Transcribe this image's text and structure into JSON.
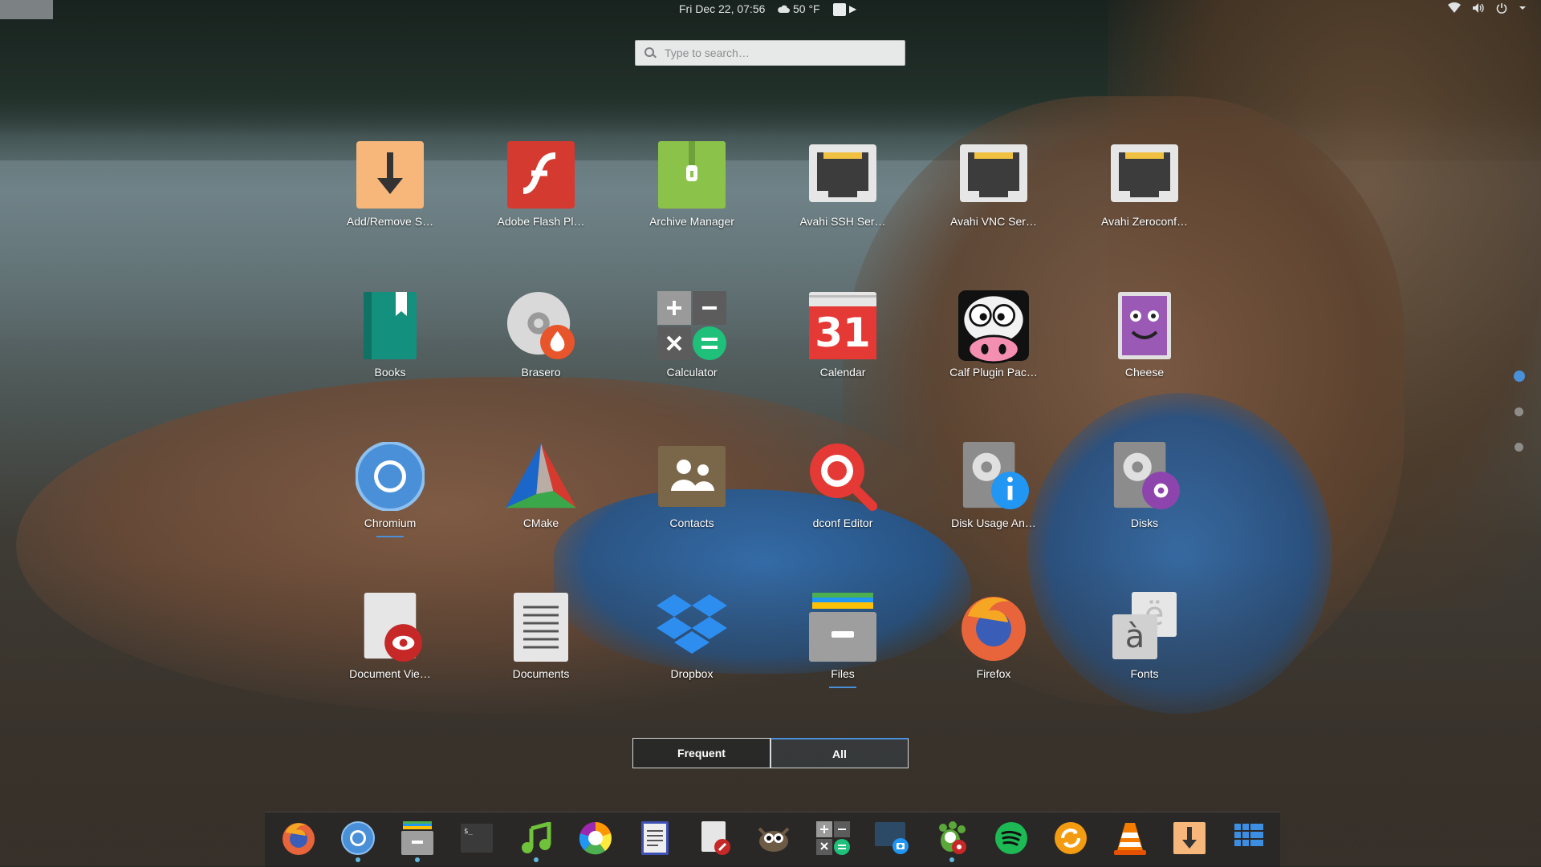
{
  "topbar": {
    "clock": "Fri Dec 22, 07:56",
    "weather": "50 °F"
  },
  "search": {
    "placeholder": "Type to search…"
  },
  "apps": [
    {
      "label": "Add/Remove S…",
      "icon": "package-install-icon",
      "running": false
    },
    {
      "label": "Adobe Flash Pl…",
      "icon": "flash-icon",
      "running": false
    },
    {
      "label": "Archive Manager",
      "icon": "archive-icon",
      "running": false
    },
    {
      "label": "Avahi SSH Ser…",
      "icon": "network-port-icon",
      "running": false
    },
    {
      "label": "Avahi VNC Ser…",
      "icon": "network-port-icon",
      "running": false
    },
    {
      "label": "Avahi Zeroconf…",
      "icon": "network-port-icon",
      "running": false
    },
    {
      "label": "Books",
      "icon": "books-icon",
      "running": false
    },
    {
      "label": "Brasero",
      "icon": "disc-burner-icon",
      "running": false
    },
    {
      "label": "Calculator",
      "icon": "calculator-icon",
      "running": false
    },
    {
      "label": "Calendar",
      "icon": "calendar-icon",
      "running": false
    },
    {
      "label": "Calf Plugin Pac…",
      "icon": "calf-cow-icon",
      "running": false
    },
    {
      "label": "Cheese",
      "icon": "cheese-icon",
      "running": false
    },
    {
      "label": "Chromium",
      "icon": "chromium-icon",
      "running": true
    },
    {
      "label": "CMake",
      "icon": "cmake-icon",
      "running": false
    },
    {
      "label": "Contacts",
      "icon": "contacts-icon",
      "running": false
    },
    {
      "label": "dconf Editor",
      "icon": "dconf-search-icon",
      "running": false
    },
    {
      "label": "Disk Usage An…",
      "icon": "disk-usage-icon",
      "running": false
    },
    {
      "label": "Disks",
      "icon": "disks-icon",
      "running": false
    },
    {
      "label": "Document Vie…",
      "icon": "document-viewer-icon",
      "running": false
    },
    {
      "label": "Documents",
      "icon": "documents-icon",
      "running": false
    },
    {
      "label": "Dropbox",
      "icon": "dropbox-icon",
      "running": false
    },
    {
      "label": "Files",
      "icon": "files-icon",
      "running": true
    },
    {
      "label": "Firefox",
      "icon": "firefox-icon",
      "running": false
    },
    {
      "label": "Fonts",
      "icon": "fonts-icon",
      "running": false
    }
  ],
  "fonts_glyphs": {
    "back": "ë",
    "front": "à"
  },
  "calendar_day": "31",
  "modes": {
    "frequent": "Frequent",
    "all": "All",
    "active": "All"
  },
  "page_indicator": {
    "pages": 3,
    "current": 1
  },
  "dock": [
    {
      "icon": "firefox-icon",
      "running": false
    },
    {
      "icon": "chromium-icon",
      "running": true
    },
    {
      "icon": "files-icon",
      "running": true
    },
    {
      "icon": "terminal-icon",
      "running": false
    },
    {
      "icon": "music-icon",
      "running": true
    },
    {
      "icon": "color-wheel-icon",
      "running": false
    },
    {
      "icon": "text-editor-icon",
      "running": false
    },
    {
      "icon": "document-edit-icon",
      "running": false
    },
    {
      "icon": "gimp-icon",
      "running": false
    },
    {
      "icon": "calculator-icon",
      "running": false
    },
    {
      "icon": "screenshot-icon",
      "running": false
    },
    {
      "icon": "gear-paw-icon",
      "running": true
    },
    {
      "icon": "spotify-icon",
      "running": false
    },
    {
      "icon": "sync-icon",
      "running": false
    },
    {
      "icon": "vlc-icon",
      "running": false
    },
    {
      "icon": "download-icon",
      "running": false
    },
    {
      "icon": "app-grid-icon",
      "running": false
    }
  ],
  "colors": {
    "accent": "#4a90d9",
    "running_indicator": "#5fb9e0"
  }
}
